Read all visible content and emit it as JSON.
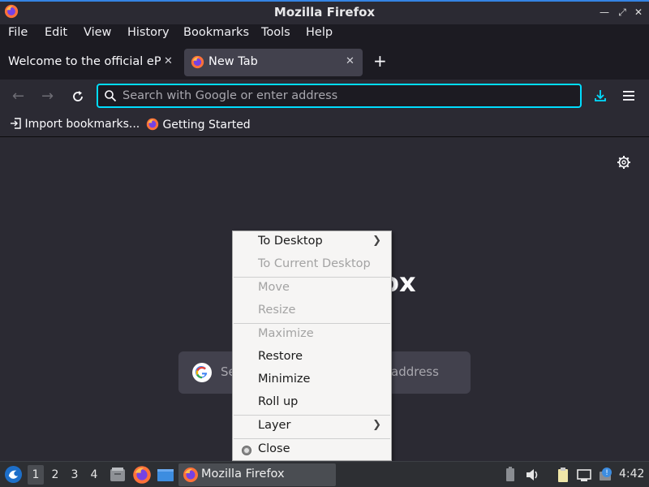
{
  "window": {
    "title": "Mozilla Firefox"
  },
  "menubar": {
    "items": [
      "File",
      "Edit",
      "View",
      "History",
      "Bookmarks",
      "Tools",
      "Help"
    ]
  },
  "tabs": [
    {
      "label": "Welcome to the official ePSX",
      "active": false
    },
    {
      "label": "New Tab",
      "active": true
    }
  ],
  "navbar": {
    "url_placeholder": "Search with Google or enter address"
  },
  "bookmarks": [
    {
      "label": "Import bookmarks...",
      "icon": "import-icon"
    },
    {
      "label": "Getting Started",
      "icon": "firefox-icon"
    }
  ],
  "content": {
    "wordmark_partial": "ox",
    "search_placeholder_left": "Se",
    "search_placeholder_right": "address"
  },
  "context_menu": {
    "items": [
      {
        "label": "To Desktop",
        "enabled": true,
        "submenu": true
      },
      {
        "label": "To Current Desktop",
        "enabled": false,
        "submenu": false
      },
      {
        "label": "Move",
        "enabled": false,
        "submenu": false
      },
      {
        "label": "Resize",
        "enabled": false,
        "submenu": false
      },
      {
        "label": "Maximize",
        "enabled": false,
        "submenu": false
      },
      {
        "label": "Restore",
        "enabled": true,
        "submenu": false
      },
      {
        "label": "Minimize",
        "enabled": true,
        "submenu": false
      },
      {
        "label": "Roll up",
        "enabled": true,
        "submenu": false
      },
      {
        "label": "Layer",
        "enabled": true,
        "submenu": true
      },
      {
        "label": "Close",
        "enabled": true,
        "submenu": false
      }
    ]
  },
  "taskbar": {
    "desktops": [
      "1",
      "2",
      "3",
      "4"
    ],
    "active_desktop": "1",
    "window_button_label": "Mozilla Firefox",
    "clock": "4:42"
  },
  "colors": {
    "accent": "#00ddff",
    "titlebar_border": "#3584e4",
    "content_bg": "#2b2a33",
    "menu_bg": "#f6f5f4"
  }
}
